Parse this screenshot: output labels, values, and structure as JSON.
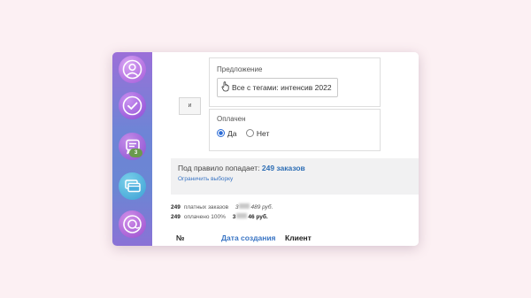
{
  "sidebar": {
    "items": [
      {
        "icon": "profile-icon"
      },
      {
        "icon": "checkmark-icon"
      },
      {
        "icon": "chat-icon",
        "badge": "3"
      },
      {
        "icon": "cards-icon"
      },
      {
        "icon": "support-icon"
      }
    ]
  },
  "rule": {
    "and_label": "и",
    "offer": {
      "label": "Предложение",
      "value": "Все с тегами: интенсив 2022"
    },
    "paid": {
      "label": "Оплачен",
      "options": [
        "Да",
        "Нет"
      ],
      "selected": "Да"
    }
  },
  "summary": {
    "prefix": "Под правило попадает:",
    "count": "249 заказов",
    "limit_link": "Ограничить выборку"
  },
  "stats": {
    "row1": {
      "n": "249",
      "label": "платных заказов",
      "amount_start": "3",
      "amount_end": "489 руб."
    },
    "row2": {
      "n": "249",
      "label": "оплачено 100%",
      "amount_start": "3",
      "amount_end": "46 руб."
    }
  },
  "table": {
    "columns": [
      "№",
      "Дата создания",
      "Клиент"
    ]
  },
  "colors": {
    "accent": "#2f6fb5",
    "badge": "#6a9a4d",
    "background": "#fcf0f3"
  }
}
